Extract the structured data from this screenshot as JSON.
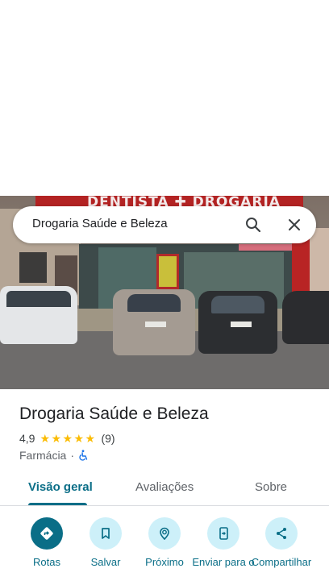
{
  "search": {
    "query": "Drogaria Saúde e Beleza"
  },
  "photo": {
    "sign_text": "DENTISTA ✚ DROGARIA"
  },
  "place": {
    "name": "Drogaria Saúde e Beleza",
    "rating": "4,9",
    "stars": 5,
    "review_count": "(9)",
    "category": "Farmácia",
    "separator": "·"
  },
  "tabs": [
    {
      "label": "Visão geral",
      "active": true
    },
    {
      "label": "Avaliações",
      "active": false
    },
    {
      "label": "Sobre",
      "active": false
    }
  ],
  "actions": [
    {
      "label": "Rotas",
      "icon": "directions-icon"
    },
    {
      "label": "Salvar",
      "icon": "bookmark-icon"
    },
    {
      "label": "Próximo",
      "icon": "nearby-icon"
    },
    {
      "label": "Enviar para o",
      "icon": "send-to-phone-icon"
    },
    {
      "label": "Compartilhar",
      "icon": "share-icon"
    }
  ],
  "colors": {
    "accent": "#0a6e87",
    "star": "#fbbc04",
    "action_bg": "#cdf0f9"
  }
}
